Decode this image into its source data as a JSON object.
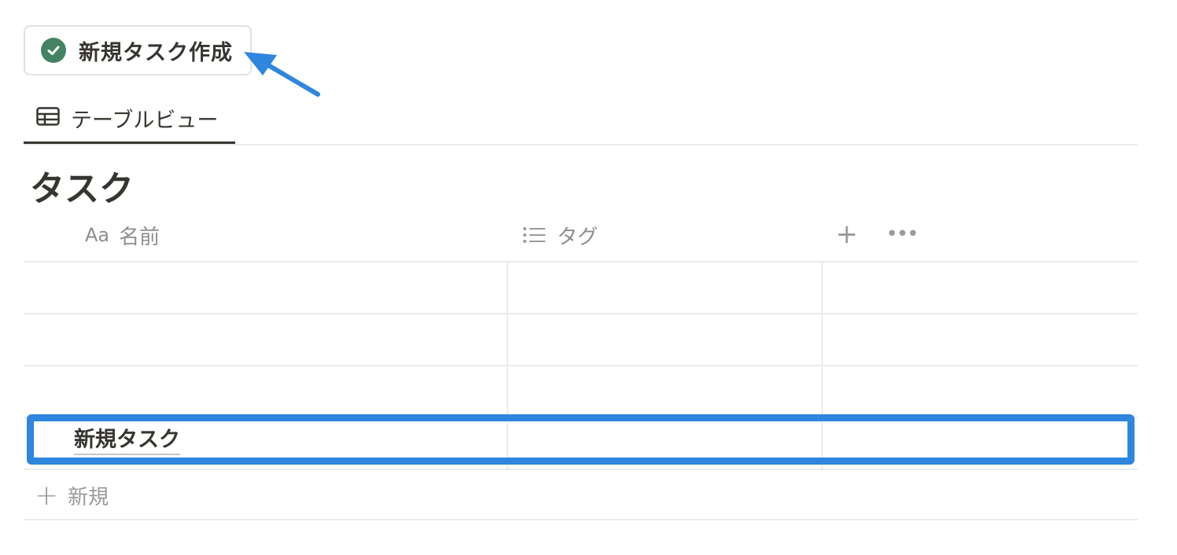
{
  "button": {
    "label": "新規タスク作成",
    "icon": "check-circle-icon",
    "icon_color": "#448361"
  },
  "view_tab": {
    "label": "テーブルビュー",
    "icon": "table-icon"
  },
  "database": {
    "title": "タスク"
  },
  "columns": [
    {
      "prefix": "Aa",
      "label": "名前",
      "icon": "text-aa-icon"
    },
    {
      "label": "タグ",
      "icon": "list-icon"
    }
  ],
  "header_actions": {
    "add": "+",
    "more": "•••"
  },
  "rows": [
    {
      "name": ""
    },
    {
      "name": ""
    },
    {
      "name": ""
    },
    {
      "name": "新規タスク"
    }
  ],
  "new_row": {
    "plus": "+",
    "label": "新規"
  },
  "colors": {
    "highlight": "#2e86de",
    "arrow": "#2e86de"
  }
}
